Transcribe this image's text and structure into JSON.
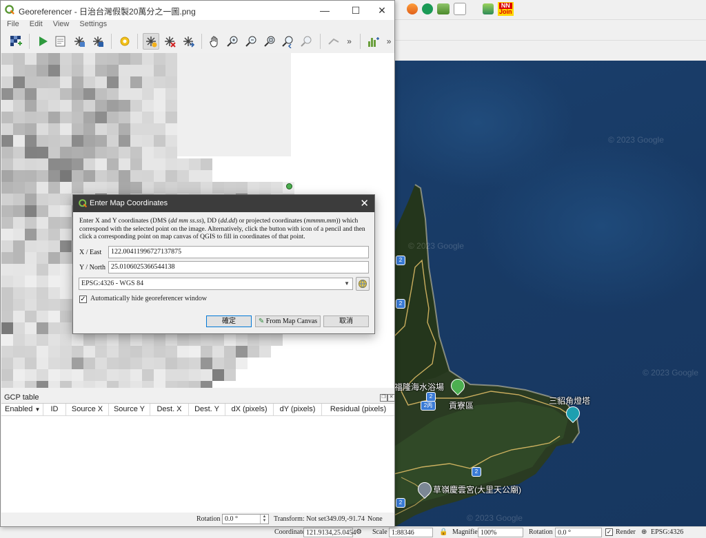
{
  "qgis": {
    "nnjoin_top": "NN",
    "nnjoin_bottom": "Join"
  },
  "map": {
    "watermark": "© 2023 Google",
    "labels": {
      "beach": "福隆海水浴場",
      "gongliao": "貢寮區",
      "lighthouse": "三貂角燈塔",
      "temple": "草嶺慶雲宮(大里天公廟)"
    },
    "road_numbers": [
      "2",
      "2",
      "2",
      "2丙",
      "2",
      "2"
    ]
  },
  "statusbar": {
    "coordinate_label": "Coordinate",
    "coordinate_value": "121.9134,25.0454",
    "scale_label": "Scale",
    "scale_value": "1:88346",
    "magnifier_label": "Magnifier",
    "magnifier_value": "100%",
    "rotation_label": "Rotation",
    "rotation_value": "0.0 °",
    "render_label": "Render",
    "crs": "EPSG:4326"
  },
  "georeferencer": {
    "title": "Georeferencer - 日治台灣假製20萬分之一圖.png",
    "window_controls": {
      "minimize": "—",
      "maximize": "☐",
      "close": "✕"
    },
    "menu": [
      "File",
      "Edit",
      "View",
      "Settings"
    ],
    "toolbar_more": "»",
    "gcp_title": "GCP table",
    "gcp_columns": [
      "Enabled",
      "ID",
      "Source X",
      "Source Y",
      "Dest. X",
      "Dest. Y",
      "dX (pixels)",
      "dY (pixels)",
      "Residual (pixels)"
    ],
    "status": {
      "rotation_label": "Rotation",
      "rotation_value": "0.0 °",
      "transform": "Transform: Not set",
      "coords": "349.09,-91.74",
      "none": "None"
    }
  },
  "dialog": {
    "title": "Enter Map Coordinates",
    "description_parts": {
      "p1": "Enter X and Y coordinates (DMS (",
      "dms": "dd mm ss.ss",
      "p2": "), DD (",
      "dd": "dd.dd",
      "p3": ") or projected coordinates (",
      "proj": "mmmm.mm",
      "p4": ")) which correspond with the selected point on the image. Alternatively, click the button with icon of a pencil and then click a corresponding point on map canvas of QGIS to fill in coordinates of that point."
    },
    "x_label": "X / East",
    "x_value": "122.00411996727137875",
    "y_label": "Y / North",
    "y_value": "25.0106025366544138",
    "crs_value": "EPSG:4326 - WGS 84",
    "auto_hide_label": "Automatically hide georeferencer window",
    "auto_hide_checked": true,
    "ok_button": "確定",
    "from_canvas_button": "From Map Canvas",
    "cancel_button": "取消"
  }
}
